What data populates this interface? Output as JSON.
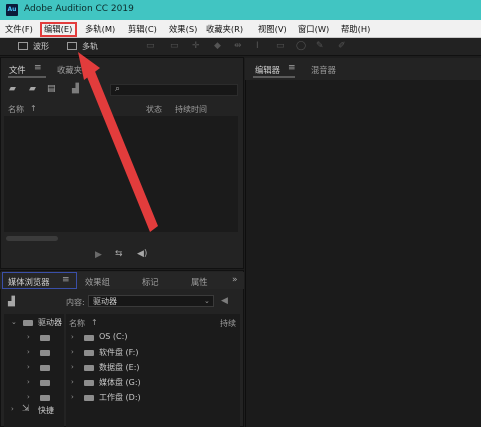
{
  "window": {
    "app_logo": "Au",
    "title": "Adobe Audition CC 2019"
  },
  "menubar": {
    "items": [
      "文件(F)",
      "编辑(E)",
      "多轨(M)",
      "剪辑(C)",
      "效果(S)",
      "收藏夹(R)",
      "视图(V)",
      "窗口(W)",
      "帮助(H)"
    ],
    "highlighted_index": 1,
    "highlight_color": "#e23c3c"
  },
  "toolbar": {
    "waveform_label": "波形",
    "multitrack_label": "多轨"
  },
  "files_panel": {
    "tab_files": "文件",
    "tab_favorites": "收藏夹",
    "search_placeholder": "",
    "col_name": "名称",
    "col_status": "状态",
    "col_duration": "持续时间"
  },
  "editor_panel": {
    "tab_editor": "编辑器",
    "tab_mixer": "混音器"
  },
  "media_panel": {
    "tabs": [
      "媒体浏览器",
      "效果组",
      "标记",
      "属性"
    ],
    "content_label": "内容:",
    "content_value": "驱动器",
    "left_tree": {
      "drives_label": "驱动器",
      "shortcuts_label": "快捷"
    },
    "col_name": "名称",
    "col_duration": "持续",
    "drives": [
      "OS (C:)",
      "软件盘 (F:)",
      "数据盘 (E:)",
      "媒体盘 (G:)",
      "工作盘 (D:)"
    ]
  },
  "colors": {
    "titlebar": "#41c5c2",
    "annotation_red": "#e23c3c"
  }
}
